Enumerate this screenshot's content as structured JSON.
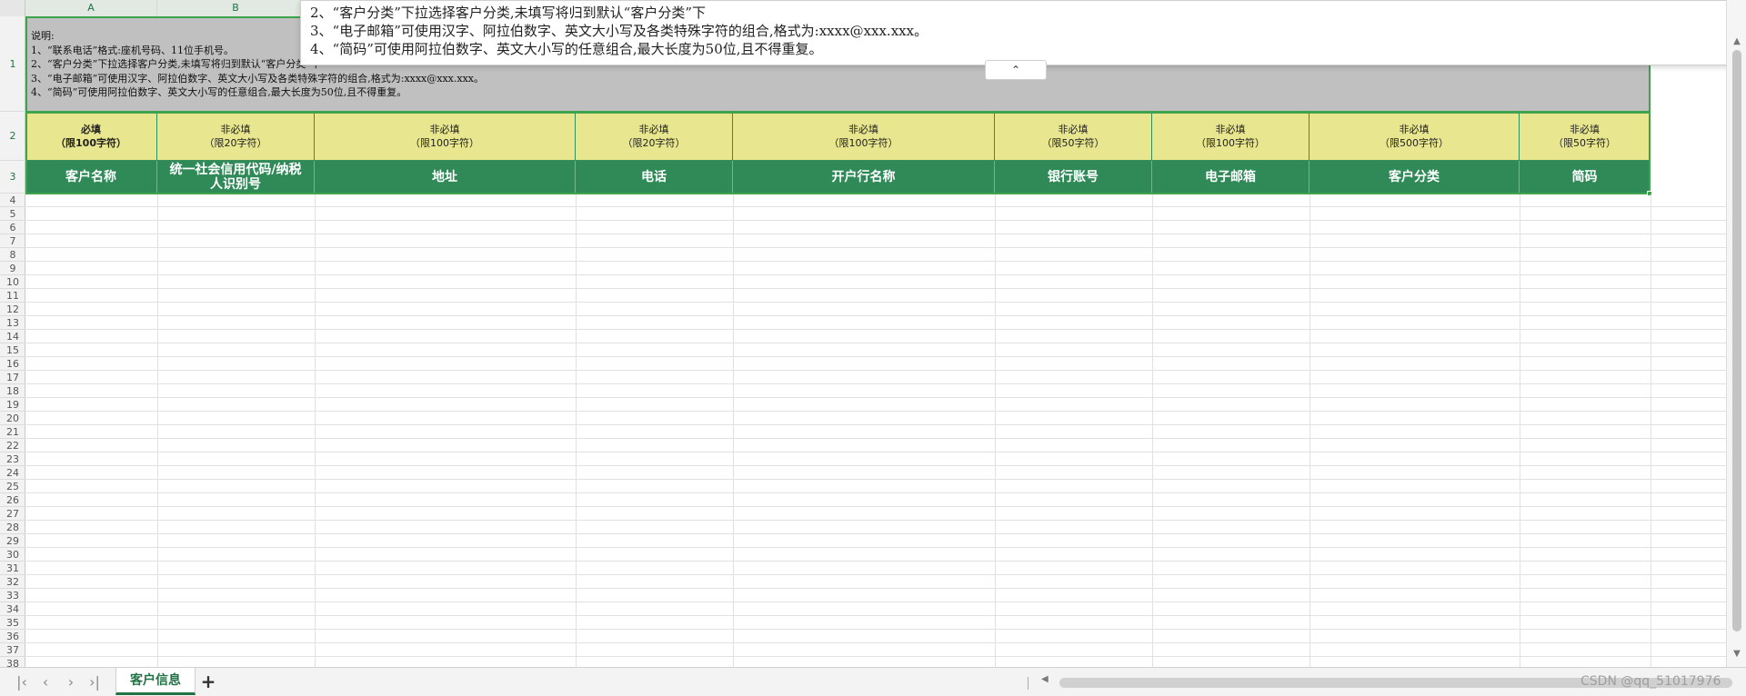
{
  "columns": [
    "A",
    "B",
    "",
    "",
    "",
    "",
    "",
    "",
    ""
  ],
  "rows": [
    "1",
    "2",
    "3",
    "4",
    "5",
    "6",
    "7",
    "8",
    "9",
    "10",
    "11",
    "12",
    "13",
    "14",
    "15",
    "16",
    "17",
    "18",
    "19",
    "20",
    "21",
    "22",
    "23",
    "24",
    "25",
    "26",
    "27",
    "28",
    "29",
    "30",
    "31",
    "32",
    "33",
    "34",
    "35",
    "36",
    "37",
    "38"
  ],
  "note": {
    "title": "说明:",
    "line1": "1、“联系电话”格式:座机号码、11位手机号。",
    "line2": "2、“客户分类”下拉选择客户分类,未填写将归到默认“客户分类”下",
    "line3": "3、“电子邮箱”可使用汉字、阿拉伯数字、英文大小写及各类特殊字符的组合,格式为:xxxx@xxx.xxx。",
    "line4": "4、“简码”可使用阿拉伯数字、英文大小写的任意组合,最大长度为50位,且不得重复。"
  },
  "popup": {
    "line2": "2、“客户分类”下拉选择客户分类,未填写将归到默认“客户分类”下",
    "line3": "3、“电子邮箱”可使用汉字、阿拉伯数字、英文大小写及各类特殊字符的组合,格式为:xxxx@xxx.xxx。",
    "line4": "4、“简码”可使用阿拉伯数字、英文大小写的任意组合,最大长度为50位,且不得重复。",
    "collapse_icon": "chevron-up-icon"
  },
  "requirements": [
    {
      "req": "必填",
      "limit": "（限100字符）"
    },
    {
      "req": "非必填",
      "limit": "（限20字符）"
    },
    {
      "req": "非必填",
      "limit": "（限100字符）"
    },
    {
      "req": "非必填",
      "limit": "（限20字符）"
    },
    {
      "req": "非必填",
      "limit": "（限100字符）"
    },
    {
      "req": "非必填",
      "limit": "（限50字符）"
    },
    {
      "req": "非必填",
      "limit": "（限100字符）"
    },
    {
      "req": "非必填",
      "limit": "（限500字符）"
    },
    {
      "req": "非必填",
      "limit": "（限50字符）"
    }
  ],
  "headers": [
    "客户名称",
    "统一社会信用代码/纳税人识别号",
    "地址",
    "电话",
    "开户行名称",
    "银行账号",
    "电子邮箱",
    "客户分类",
    "简码"
  ],
  "sheet_tab": "客户信息",
  "add_sheet": "+",
  "watermark": "CSDN @qq_51017976",
  "colors": {
    "header_green": "#2f8a58",
    "req_yellow": "#e8e68e",
    "note_gray": "#c0c0c0",
    "accent": "#217346"
  }
}
